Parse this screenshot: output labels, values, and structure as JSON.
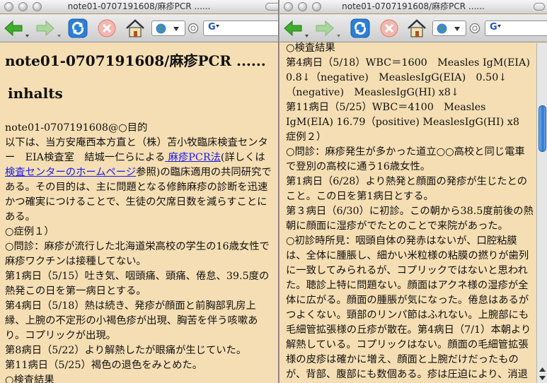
{
  "left_window": {
    "title": "note01-0707191608/麻疹PCR ......",
    "search_engine": "G",
    "heading": "note01-0707191608/麻疹PCR ......",
    "subheading": "inhalts",
    "paragraphs": [
      {
        "before": "note01-0707191608@○目的\n以下は、当方安庵西本方直と（株）苫小牧臨床検査センター　EIA検査室　結城一仁らによる",
        "link": " 麻疹PCR法",
        "after": "(詳しくは"
      },
      {
        "before": "",
        "link": "検査センターのホームページ",
        "after": "参照)の臨床適用の共同研究である。その目的は、主に問題となる修飾麻疹の診断を迅速かつ確実につけることで、生徒の欠席日数を減らすことにある。"
      },
      {
        "before": "○症例１）",
        "link": "",
        "after": ""
      },
      {
        "before": "○問診：麻疹が流行した北海道栄高校の学生の16歳女性で麻疹ワクチンは接種してない。",
        "link": "",
        "after": ""
      },
      {
        "before": "第1病日（5/15）吐き気、咽頭痛、頭痛、倦怠、39.5度の熱発この日を第一病日とする。",
        "link": "",
        "after": ""
      },
      {
        "before": "第4病日（5/18）熱は続き、発疹が顔面と前胸部乳房上縁、上腕の不定形の小褐色疹が出現、胸苦を伴う咳嗽あり。コプリックが出現。",
        "link": "",
        "after": ""
      },
      {
        "before": "第8病日（5/22）より解熱したが眼痛が生じていた。",
        "link": "",
        "after": ""
      },
      {
        "before": "第11病日（5/25）褐色の退色をみとめた。",
        "link": "",
        "after": ""
      },
      {
        "before": "○検査結果",
        "link": "",
        "after": ""
      }
    ]
  },
  "right_window": {
    "title": "note01-0707191608/麻疹PCR ......",
    "search_engine": "G",
    "paragraphs": [
      "○検査結果",
      "第4病日（5/18）WBC＝1600　Measles IgM(EIA) 0.8↓（negative)　MeaslesIgG(EIA)　0.50↓（negative)　MeaslesIgG(HI) x8↓",
      "第11病日（5/25）WBC＝4100　Measles IgM(EIA) 16.79（positive) MeaslesIgG(HI) x8",
      "症例２）",
      "○問診：麻疹発生が多かった道立○○高校と同じ電車で登別の高校に通う16歳女性。",
      "第1病日（6/28）より熱発と顔面の発疹が生じたとのこと。この日を第1病日とする。",
      "第３病日（6/30）に初診。この朝から38.5度前後の熱朝に顔面に湿疹がでたとのことで来院があった。",
      "○初診時所見：咽頭自体の発赤はないが、口腔粘膜は、全体に腫脹し、細かい米粒様の粘膜の撚りが歯列に一致してみられるが、コプリックではないと思われた。聴診上特に問題ない。顔面はアクネ様の湿疹が全体に広がる。顔面の腫脹が気になった。倦怠はあるがつよくない。頸部のリンパ節はふれない。上腕部にも毛細管拡張様の丘疹が散在。第4病日（7/1）本朝より解熱している。コプリックはない。顔面の毛細管拡張様の皮疹は確かに増え、顔面と上腕だけだったものが、背部、腹部にも数個ある。疹は圧迫により、消退"
    ]
  },
  "colors": {
    "page_background": "#f5deb3",
    "link": "#1a1aee",
    "back_arrow": "#3fae2a",
    "reload": "#2d7fd6",
    "stop": "#e05a4a",
    "scroll_thumb": "#2c76d0"
  },
  "icons": [
    "back-arrow-icon",
    "forward-arrow-icon",
    "reload-icon",
    "stop-icon",
    "home-icon",
    "globe-icon",
    "search-go-icon"
  ]
}
